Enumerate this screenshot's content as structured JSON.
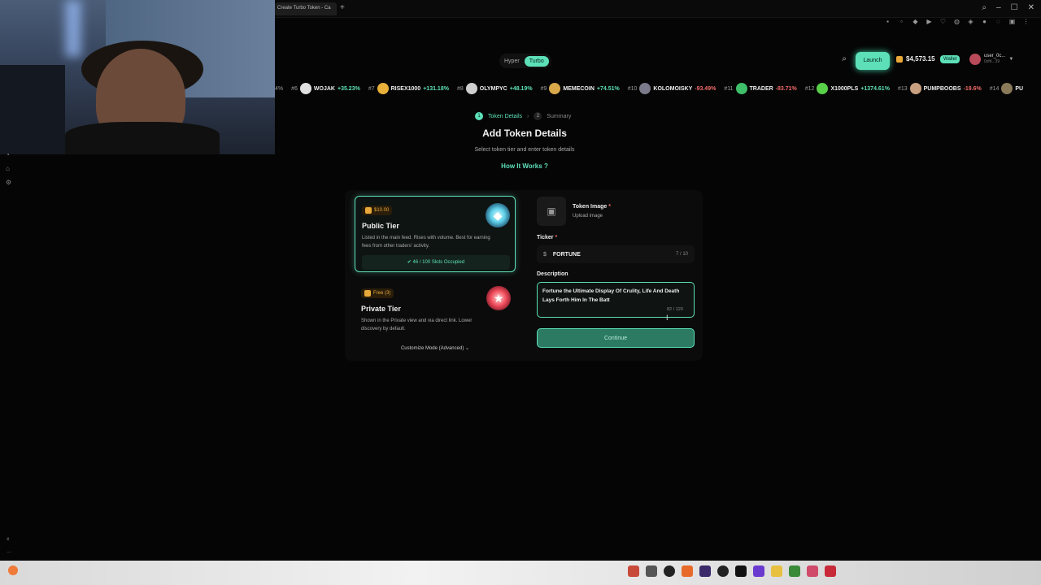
{
  "browser": {
    "tab_title": "Create Turbo Token - Ca",
    "new_tab": "+"
  },
  "nav": {
    "mode_options": [
      "Hyper",
      "Turbo"
    ],
    "active_mode": "Turbo",
    "launch_label": "Launch",
    "balance": "$4,573.15",
    "wallet_label": "Wallet",
    "user_name": "user_0c...",
    "user_addr": "0xfd...39"
  },
  "ticker": [
    {
      "rank": "4%",
      "name": "",
      "change": "",
      "color": "#5de0b8",
      "dir": "up"
    },
    {
      "rank": "#6",
      "name": "WOJAK",
      "change": "+35.23%",
      "color": "#e0e0e0",
      "dir": "up"
    },
    {
      "rank": "#7",
      "name": "RISEX1000",
      "change": "+131.18%",
      "color": "#e8b03a",
      "dir": "up"
    },
    {
      "rank": "#8",
      "name": "OLYMPYC",
      "change": "+48.19%",
      "color": "#cfcfcf",
      "dir": "up"
    },
    {
      "rank": "#9",
      "name": "MEMECOIN",
      "change": "+74.51%",
      "color": "#d9a84a",
      "dir": "up"
    },
    {
      "rank": "#10",
      "name": "KOLOMOISKY",
      "change": "-93.49%",
      "color": "#7a7a8a",
      "dir": "down"
    },
    {
      "rank": "#11",
      "name": "TRADER",
      "change": "-83.71%",
      "color": "#3fbf6a",
      "dir": "down"
    },
    {
      "rank": "#12",
      "name": "X1000PLS",
      "change": "+1374.61%",
      "color": "#58d048",
      "dir": "up"
    },
    {
      "rank": "#13",
      "name": "PUMPBOOBS",
      "change": "-19.6%",
      "color": "#c8a080",
      "dir": "down"
    },
    {
      "rank": "#14",
      "name": "PUMPBOOBS",
      "change": "",
      "color": "#8a7a5a",
      "dir": "up"
    }
  ],
  "stepper": {
    "step1_num": "1",
    "step1_label": "Token Details",
    "step2_num": "2",
    "step2_label": "Summary"
  },
  "page": {
    "title": "Add Token Details",
    "subtitle": "Select token tier and enter token details",
    "how_link": "How It Works"
  },
  "tiers": {
    "public": {
      "price": "$10.00",
      "name": "Public Tier",
      "desc": "Listed in the main feed. Rises with volume. Best for earning fees from other traders' activity.",
      "slots": "46 / 100 Slots Occupied"
    },
    "private": {
      "price": "Free (3)",
      "name": "Private Tier",
      "desc": "Shown in the Private view and via direct link. Lower discovery by default."
    },
    "customize_label": "Customize Mode (Advanced)"
  },
  "form": {
    "image_label": "Token Image",
    "required_mark": "*",
    "image_sub": "Upload image",
    "ticker_label": "Ticker",
    "ticker_prefix": "$",
    "ticker_value": "FORTUNE",
    "ticker_count": "7 / 10",
    "desc_label": "Description",
    "desc_value": "Fortune the Ultimate Display Of Crulity, Life And Death Lays Forth Him In The Batt",
    "desc_count": "82 / 120",
    "continue_label": "Continue"
  },
  "colors": {
    "accent": "#5de0b8",
    "gold": "#e8a93a",
    "negative": "#f26b6b"
  },
  "icons": {
    "search": "search-icon",
    "image": "image-icon",
    "check": "check-circle-icon",
    "chevron": "chevron-down-icon",
    "help": "help-circle-icon"
  }
}
